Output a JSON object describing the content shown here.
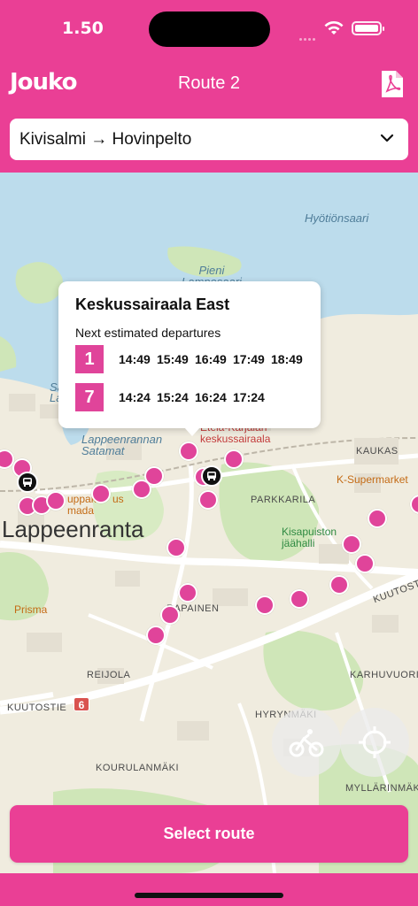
{
  "status_bar": {
    "time": "1.50"
  },
  "header": {
    "logo": "Jouko",
    "title": "Route 2",
    "pdf_icon": "pdf-file-icon"
  },
  "route_select": {
    "value": "Kivisalmi → Hovinpelto",
    "icon": "chevron-down-icon"
  },
  "map": {
    "labels": {
      "hyotionsaari": "Hyötiönsaari",
      "pieni_lamposaari": "Pieni\nLamposaari",
      "lappeenrannan_satamat": "Lappeenrannan\nSatamat",
      "sa_fragment": "Sa",
      "la_fragment": "La",
      "etela_karjalan": "Etelä-Karjalan\nkeskussairaala",
      "kaukas": "KAUKAS",
      "k_supermarket": "K-Supermarket",
      "parkkarila": "PARKKARILA",
      "kisapuiston": "Kisapuiston\njäähalli",
      "lappeenranta": "Lappeenranta",
      "uppak_fragment": "uppak",
      "us_fragment": "us",
      "mada_fragment": "mada",
      "prisma": "Prisma",
      "rapainen": "RAPAINEN",
      "kuutostie_right": "KUUTOSTIE",
      "reijola": "REIJOLA",
      "karhuvuori": "KARHUVUORI",
      "kuutostie_left": "KUUTOSTIE",
      "road_6": "6",
      "hyrynmaki": "HYRYNMÄKI",
      "kourulanmaki": "KOURULANMÄKI",
      "myllarinmaki": "MYLLÄRINMÄKI"
    }
  },
  "popup": {
    "title": "Keskussairaala East",
    "subtitle": "Next estimated departures",
    "departures": [
      {
        "line": "1",
        "times": [
          "14:49",
          "15:49",
          "16:49",
          "17:49",
          "18:49"
        ]
      },
      {
        "line": "7",
        "times": [
          "14:24",
          "15:24",
          "16:24",
          "17:24"
        ]
      }
    ]
  },
  "controls": {
    "bike_icon": "bicycle-icon",
    "locate_icon": "crosshair-icon"
  },
  "footer": {
    "select_route": "Select route"
  }
}
